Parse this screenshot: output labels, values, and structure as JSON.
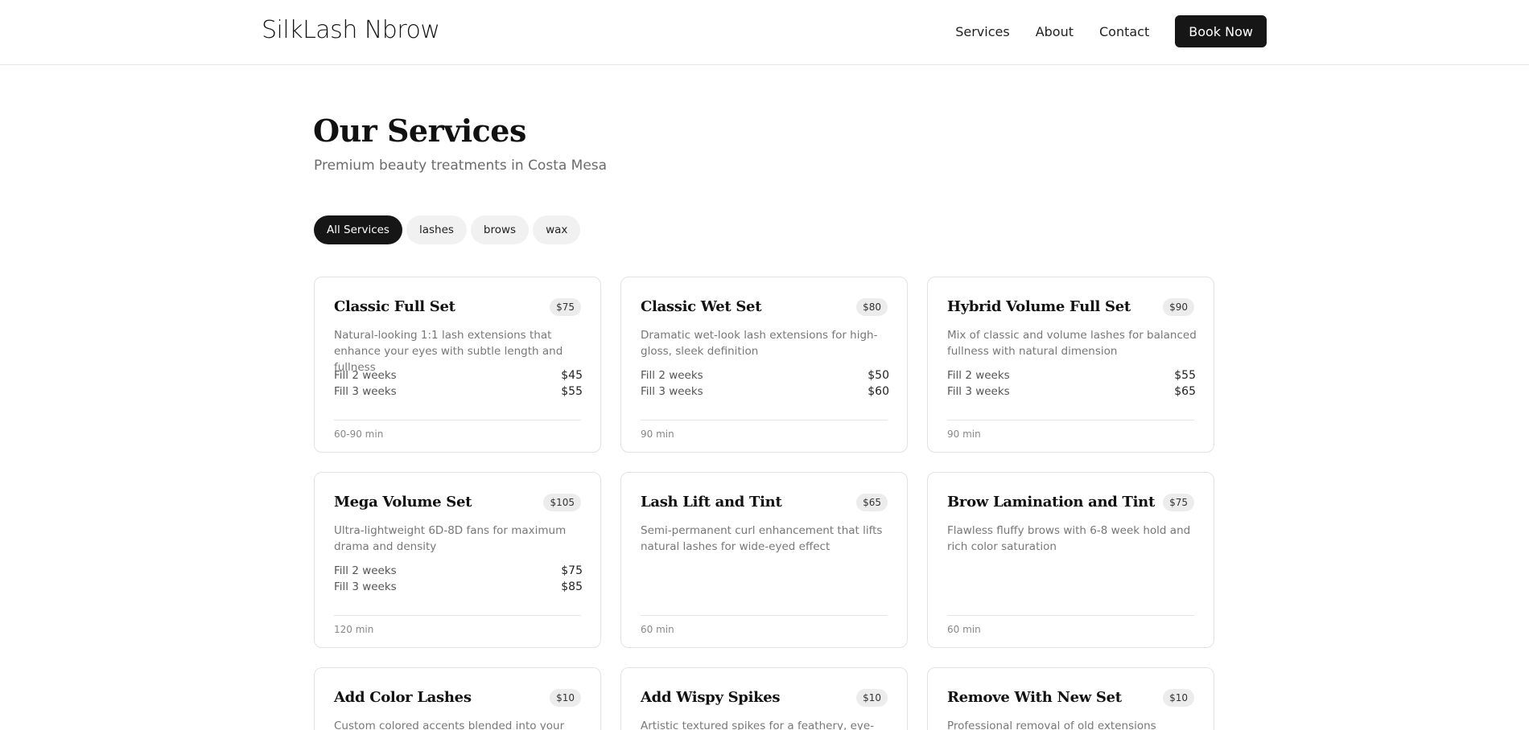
{
  "header": {
    "brand": "SilkLash Nbrow",
    "nav": [
      "Services",
      "About",
      "Contact"
    ],
    "cta": "Book Now"
  },
  "hero": {
    "title": "Our Services",
    "subtitle": "Premium beauty treatments in Costa Mesa"
  },
  "filters": {
    "active": "All Services",
    "items": [
      "All Services",
      "lashes",
      "brows",
      "wax"
    ]
  },
  "services": [
    {
      "name": "Classic Full Set",
      "price": "$75",
      "description": "Natural-looking 1:1 lash extensions that enhance your eyes with subtle length and fullness",
      "fills": [
        {
          "label": "Fill 2 weeks",
          "price": "$45"
        },
        {
          "label": "Fill 3 weeks",
          "price": "$55"
        }
      ],
      "duration": "60-90 min"
    },
    {
      "name": "Classic Wet Set",
      "price": "$80",
      "description": "Dramatic wet-look lash extensions for high-gloss, sleek definition",
      "fills": [
        {
          "label": "Fill 2 weeks",
          "price": "$50"
        },
        {
          "label": "Fill 3 weeks",
          "price": "$60"
        }
      ],
      "duration": "90 min"
    },
    {
      "name": "Hybrid Volume Full Set",
      "price": "$90",
      "description": "Mix of classic and volume lashes for balanced fullness with natural dimension",
      "fills": [
        {
          "label": "Fill 2 weeks",
          "price": "$55"
        },
        {
          "label": "Fill 3 weeks",
          "price": "$65"
        }
      ],
      "duration": "90 min"
    },
    {
      "name": "Mega Volume Set",
      "price": "$105",
      "description": "Ultra-lightweight 6D-8D fans for maximum drama and density",
      "fills": [
        {
          "label": "Fill 2 weeks",
          "price": "$75"
        },
        {
          "label": "Fill 3 weeks",
          "price": "$85"
        }
      ],
      "duration": "120 min"
    },
    {
      "name": "Lash Lift and Tint",
      "price": "$65",
      "description": "Semi-permanent curl enhancement that lifts natural lashes for wide-eyed effect",
      "fills": [],
      "duration": "60 min"
    },
    {
      "name": "Brow Lamination and Tint",
      "price": "$75",
      "description": "Flawless fluffy brows with 6-8 week hold and rich color saturation",
      "fills": [],
      "duration": "60 min"
    },
    {
      "name": "Add Color Lashes",
      "price": "$10",
      "description": "Custom colored accents blended into your set for",
      "fills": [],
      "duration": ""
    },
    {
      "name": "Add Wispy Spikes",
      "price": "$10",
      "description": "Artistic textured spikes for a feathery, eye-opening",
      "fills": [],
      "duration": ""
    },
    {
      "name": "Remove With New Set",
      "price": "$10",
      "description": "Professional removal of old extensions followed by",
      "fills": [],
      "duration": ""
    }
  ]
}
